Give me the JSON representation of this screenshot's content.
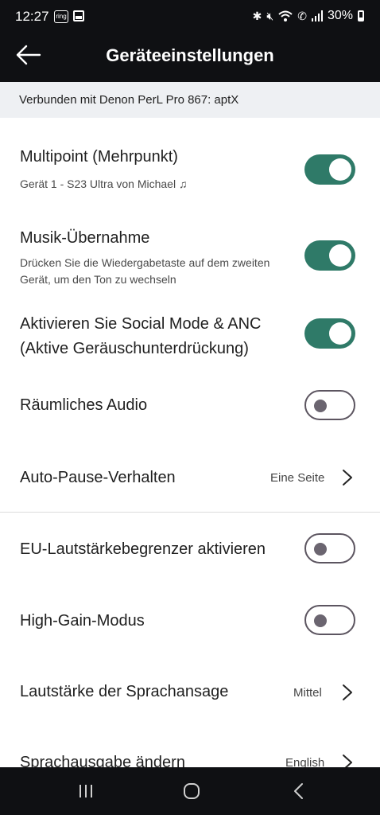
{
  "status_bar": {
    "time": "12:27",
    "badge": "ring",
    "battery": "30%",
    "icons": [
      "ring-app-icon",
      "gallery-icon",
      "bluetooth-icon",
      "mute-icon",
      "wifi-icon",
      "call-icon",
      "signal-icon",
      "battery-icon"
    ]
  },
  "header": {
    "title": "Geräteeinstellungen"
  },
  "banner": {
    "text": "Verbunden mit Denon PerL Pro 867: aptX"
  },
  "settings": {
    "multipoint": {
      "label": "Multipoint (Mehrpunkt)",
      "sub": "Gerät 1 - S23 Ultra von Michael ♫",
      "enabled": true
    },
    "music_takeover": {
      "label": "Musik-Übernahme",
      "sub": "Drücken Sie die Wiedergabetaste auf dem zweiten Gerät, um den Ton zu wechseln",
      "enabled": true
    },
    "social_mode": {
      "label": "Aktivieren Sie Social Mode & ANC (Aktive Geräuschunterdrückung)",
      "enabled": true
    },
    "spatial_audio": {
      "label": "Räumliches Audio",
      "enabled": false
    },
    "auto_pause": {
      "label": "Auto-Pause-Verhalten",
      "value": "Eine Seite"
    },
    "eu_limiter": {
      "label": "EU-Lautstärkebegrenzer aktivieren",
      "enabled": false
    },
    "high_gain": {
      "label": "High-Gain-Modus",
      "enabled": false
    },
    "prompt_volume": {
      "label": "Lautstärke der Sprachansage",
      "value": "Mittel"
    },
    "voice_language": {
      "label": "Sprachausgabe ändern",
      "value": "English"
    }
  },
  "colors": {
    "toggle_on": "#2f7a68",
    "toggle_off_border": "#5c5560",
    "header_bg": "#0f1013",
    "banner_bg": "#eef0f3"
  }
}
